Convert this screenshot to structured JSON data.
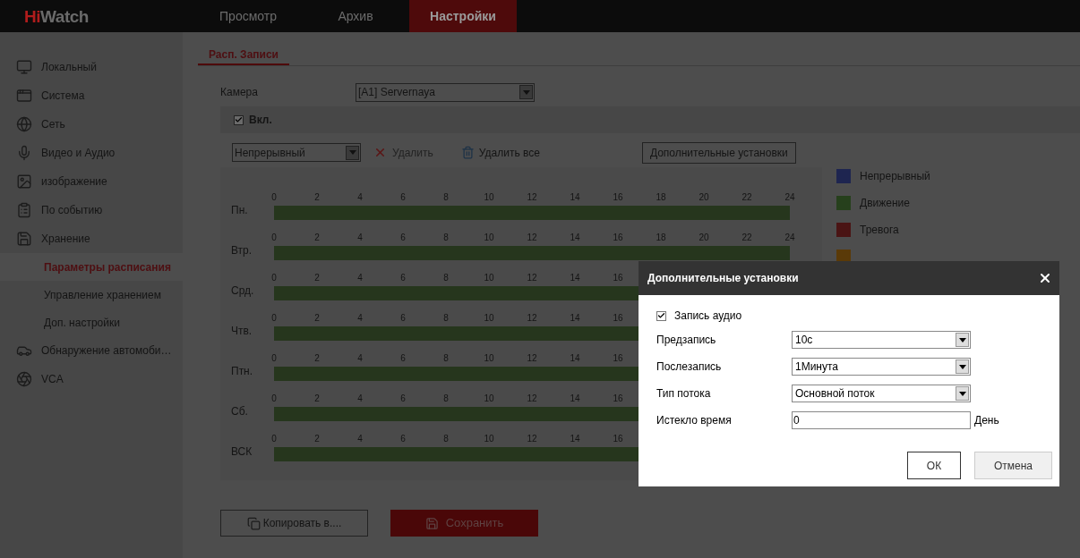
{
  "logo": {
    "accent": "Hi",
    "rest": "Watch"
  },
  "nav": [
    {
      "label": "Просмотр",
      "selected": false
    },
    {
      "label": "Архив",
      "selected": false
    },
    {
      "label": "Настройки",
      "selected": true
    }
  ],
  "sidebar": {
    "items": [
      {
        "kind": "section",
        "label": "Локальный",
        "selected": false
      },
      {
        "kind": "section",
        "label": "Система",
        "selected": false
      },
      {
        "kind": "section",
        "label": "Сеть",
        "selected": false
      },
      {
        "kind": "section",
        "label": "Видео и Аудио",
        "selected": false
      },
      {
        "kind": "section",
        "label": "изображение",
        "selected": false
      },
      {
        "kind": "section",
        "label": "По событию",
        "selected": false
      },
      {
        "kind": "section",
        "label": "Хранение",
        "selected": false
      },
      {
        "kind": "sub",
        "label": "Параметры расписания",
        "selected": true
      },
      {
        "kind": "sub",
        "label": "Управление хранением",
        "selected": false
      },
      {
        "kind": "sub",
        "label": "Доп. настройки",
        "selected": false
      },
      {
        "kind": "section",
        "label": "Обнаружение автомоби…",
        "selected": false
      },
      {
        "kind": "section",
        "label": "VCA",
        "selected": false
      }
    ]
  },
  "tabs": [
    {
      "label": "Расп. Записи",
      "selected": true
    }
  ],
  "camera": {
    "label": "Камера",
    "value": "[A1] Servernaya"
  },
  "enable": {
    "label": "Вкл.",
    "checked": true
  },
  "toolbar": {
    "mode": "Непрерывный",
    "delete": {
      "label": "Удалить",
      "disabled": true
    },
    "delete_all": {
      "label": "Удалить все",
      "disabled": false
    },
    "advanced": "Дополнительные установки"
  },
  "days": [
    {
      "label": "Пн.",
      "ticks": [
        "0",
        "2",
        "4",
        "6",
        "8",
        "10",
        "12",
        "14",
        "16",
        "18",
        "20",
        "22",
        "24"
      ],
      "level": 1
    },
    {
      "label": "Втр.",
      "ticks": [
        "0",
        "2",
        "4",
        "6",
        "8",
        "10",
        "12",
        "14",
        "16",
        "18",
        "20",
        "22",
        "24"
      ],
      "level": 1
    },
    {
      "label": "Срд.",
      "ticks": [
        "0",
        "2",
        "4",
        "6",
        "8",
        "10",
        "12",
        "14",
        "16"
      ],
      "level": 1
    },
    {
      "label": "Чтв.",
      "ticks": [
        "0",
        "2",
        "4",
        "6",
        "8",
        "10",
        "12",
        "14",
        "16"
      ],
      "level": 1
    },
    {
      "label": "Птн.",
      "ticks": [
        "0",
        "2",
        "4",
        "6",
        "8",
        "10",
        "12",
        "14",
        "16"
      ],
      "level": 1
    },
    {
      "label": "Сб.",
      "ticks": [
        "0",
        "2",
        "4",
        "6",
        "8",
        "10",
        "12",
        "14",
        "16"
      ],
      "level": 1
    },
    {
      "label": "ВСК",
      "ticks": [
        "0",
        "2",
        "4",
        "6",
        "8",
        "10",
        "12",
        "14",
        "16"
      ],
      "level": 1
    }
  ],
  "legend": [
    {
      "label": "Непрерывный",
      "color": "#1e2550"
    },
    {
      "label": "Движение",
      "color": "#26401c"
    },
    {
      "label": "Тревога",
      "color": "#4a1414"
    },
    {
      "color": "#5a3a08"
    }
  ],
  "buttons": {
    "copy": "Копировать в....",
    "save": "Сохранить"
  },
  "dialog": {
    "title": "Дополнительные установки",
    "audio": {
      "label": "Запись аудио",
      "checked": true
    },
    "fields": [
      {
        "kind": "select",
        "label": "Предзапись",
        "value": "10с"
      },
      {
        "kind": "select",
        "label": "Послезапись",
        "value": "1Минута"
      },
      {
        "kind": "select",
        "label": "Тип потока",
        "value": "Основной поток"
      },
      {
        "kind": "input",
        "label": "Истекло время",
        "value": "0",
        "unit": "День"
      }
    ],
    "ok": "ОК",
    "cancel": "Отмена"
  }
}
